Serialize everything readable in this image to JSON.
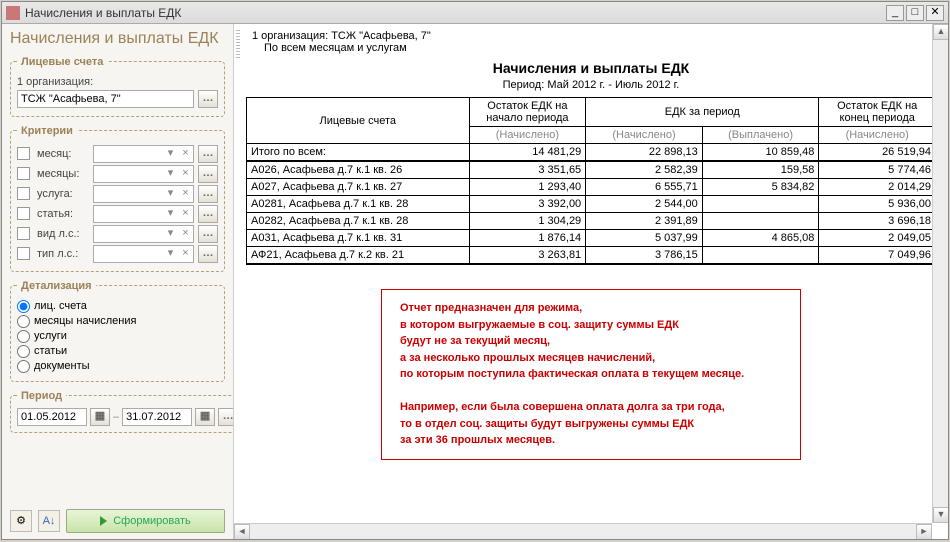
{
  "window": {
    "title": "Начисления и выплаты ЕДК"
  },
  "sidebar": {
    "heading": "Начисления и выплаты ЕДК",
    "accounts": {
      "legend": "Лицевые счета",
      "org_label": "1 организация:",
      "org_value": "ТСЖ \"Асафьева, 7\""
    },
    "criteria": {
      "legend": "Критерии",
      "items": [
        {
          "label": "месяц:"
        },
        {
          "label": "месяцы:"
        },
        {
          "label": "услуга:"
        },
        {
          "label": "статья:"
        },
        {
          "label": "вид л.с.:"
        },
        {
          "label": "тип л.с.:"
        }
      ]
    },
    "detail": {
      "legend": "Детализация",
      "options": [
        "лиц. счета",
        "месяцы начисления",
        "услуги",
        "статьи",
        "документы"
      ],
      "selected": 0
    },
    "period": {
      "legend": "Период",
      "from": "01.05.2012",
      "to": "31.07.2012"
    },
    "run_label": "Сформировать"
  },
  "report": {
    "line1": "1 организация: ТСЖ \"Асафьева, 7\"",
    "line2": "По всем месяцам и услугам",
    "title": "Начисления и выплаты ЕДК",
    "period": "Период: Май 2012 г. - Июль 2012 г.",
    "headers": {
      "col1": "Лицевые счета",
      "col2": "Остаток ЕДК на начало периода",
      "col3": "ЕДК за период",
      "col4": "Остаток ЕДК на конец периода",
      "sub_accrued": "(Начислено)",
      "sub_paid": "(Выплачено)"
    },
    "total_label": "Итого по всем:",
    "total": {
      "start": "14 481,29",
      "accrued": "22 898,13",
      "paid": "10 859,48",
      "end": "26 519,94"
    },
    "rows": [
      {
        "name": "А026, Асафьева д.7 к.1 кв. 26",
        "start": "3 351,65",
        "accrued": "2 582,39",
        "paid": "159,58",
        "end": "5 774,46"
      },
      {
        "name": "А027, Асафьева д.7 к.1 кв. 27",
        "start": "1 293,40",
        "accrued": "6 555,71",
        "paid": "5 834,82",
        "end": "2 014,29"
      },
      {
        "name": "А0281, Асафьева д.7 к.1 кв. 28",
        "start": "3 392,00",
        "accrued": "2 544,00",
        "paid": "",
        "end": "5 936,00"
      },
      {
        "name": "А0282, Асафьева д.7 к.1 кв. 28",
        "start": "1 304,29",
        "accrued": "2 391,89",
        "paid": "",
        "end": "3 696,18"
      },
      {
        "name": "А031, Асафьева д.7 к.1 кв. 31",
        "start": "1 876,14",
        "accrued": "5 037,99",
        "paid": "4 865,08",
        "end": "2 049,05"
      },
      {
        "name": "АФ21, Асафьева д.7 к.2 кв. 21",
        "start": "3 263,81",
        "accrued": "3 786,15",
        "paid": "",
        "end": "7 049,96"
      }
    ],
    "note": [
      "Отчет предназначен для режима,",
      "в котором выгружаемые в соц. защиту суммы ЕДК",
      "будут не за текущий месяц,",
      "а за несколько прошлых месяцев начислений,",
      "по которым поступила фактическая оплата в текущем месяце.",
      "",
      "Например, если была совершена оплата долга за три года,",
      "то в отдел соц. защиты будут выгружены суммы ЕДК",
      "за эти 36 прошлых месяцев."
    ]
  }
}
